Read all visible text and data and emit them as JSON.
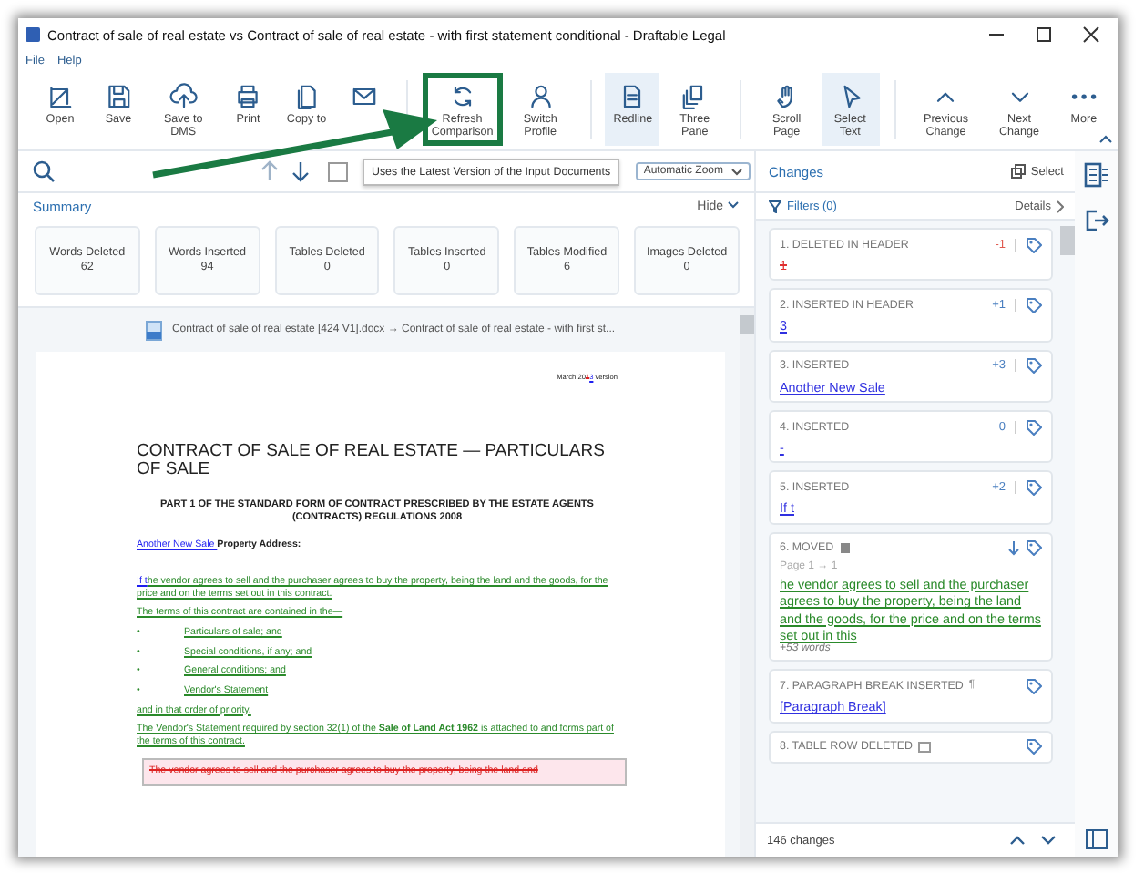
{
  "window": {
    "title": "Contract of sale of real estate vs Contract of sale of real estate - with first statement conditional - Draftable Legal"
  },
  "menu": [
    "File",
    "Help"
  ],
  "toolbar": [
    {
      "label": "Open",
      "selected": false,
      "highlighted": false,
      "separator_before": false
    },
    {
      "label": "Save",
      "selected": false,
      "highlighted": false,
      "separator_before": false
    },
    {
      "label": "Save to DMS",
      "selected": false,
      "highlighted": false,
      "separator_before": false
    },
    {
      "label": "Print",
      "selected": false,
      "highlighted": false,
      "separator_before": false
    },
    {
      "label": "Copy to",
      "selected": false,
      "highlighted": false,
      "separator_before": false
    },
    {
      "selected": false,
      "highlighted": false,
      "separator_before": false
    },
    {
      "label": "Refresh Comparison",
      "selected": false,
      "highlighted": true,
      "separator_before": true
    },
    {
      "label": "Switch Profile",
      "selected": false,
      "highlighted": false,
      "separator_before": false
    },
    {
      "label": "Redline",
      "selected": true,
      "highlighted": false,
      "separator_before": true
    },
    {
      "label": "Three Pane",
      "selected": false,
      "highlighted": false,
      "separator_before": false
    },
    {
      "label": "Scroll Page",
      "selected": false,
      "highlighted": false,
      "separator_before": true
    },
    {
      "label": "Select Text",
      "selected": true,
      "highlighted": false,
      "separator_before": false
    },
    {
      "label": "Previous Change",
      "selected": false,
      "highlighted": false,
      "separator_before": true
    },
    {
      "label": "Next Change",
      "selected": false,
      "highlighted": false,
      "separator_before": false
    },
    {
      "label": "More",
      "selected": false,
      "highlighted": false,
      "separator_before": false
    }
  ],
  "checkbox": {
    "checked": false
  },
  "tooltip": "Uses the Latest Version of the Input Documents",
  "zoom_select": "Automatic Zoom",
  "summary": {
    "title": "Summary",
    "hide": "Hide",
    "cards": [
      {
        "label": "Words Deleted",
        "value": "62"
      },
      {
        "label": "Words Inserted",
        "value": "94"
      },
      {
        "label": "Tables Deleted",
        "value": "0"
      },
      {
        "label": "Tables Inserted",
        "value": "0"
      },
      {
        "label": "Tables Modified",
        "value": "6"
      },
      {
        "label": "Images Deleted",
        "value": "0"
      }
    ]
  },
  "document": {
    "file_line": "Contract of sale of real estate [424 V1].docx → Contract of sale of real estate - with first st...",
    "header": [
      {
        "text": "March 20",
        "kind": "plain"
      },
      {
        "text": "1",
        "kind": "deleted"
      },
      {
        "text": "3",
        "kind": "inserted"
      },
      {
        "text": " version",
        "kind": "plain"
      }
    ],
    "paragraphs": [
      {
        "kind": "title",
        "segments": [
          {
            "text": "CONTRACT OF SALE OF REAL ESTATE — PARTICULARS OF SALE",
            "kind": "plain"
          }
        ]
      },
      {
        "kind": "subtitle",
        "segments": [
          {
            "text": "PART 1 OF THE STANDARD FORM OF CONTRACT PRESCRIBED BY THE ESTATE AGENTS (CONTRACTS) REGULATIONS 2008",
            "kind": "plain"
          }
        ]
      },
      {
        "kind": "para",
        "segments": [
          {
            "text": "Another New Sale ",
            "kind": "inserted"
          },
          {
            "text": "Property Address:",
            "kind": "bold"
          }
        ]
      },
      {
        "kind": "gap"
      },
      {
        "kind": "para",
        "segments": [
          {
            "text": "If t",
            "kind": "inserted"
          },
          {
            "text": "he vendor agrees to sell and the purchaser agrees to buy the property, being the land and the goods, for the price and on the terms set out in this contract.",
            "kind": "moved"
          }
        ]
      },
      {
        "kind": "para",
        "segments": [
          {
            "text": "The terms of this contract are contained in the—",
            "kind": "moved"
          }
        ]
      },
      {
        "kind": "bullet",
        "bullet": "•",
        "segments": [
          {
            "text": "Particulars of sale; and",
            "kind": "moved"
          }
        ]
      },
      {
        "kind": "bullet",
        "bullet": "•",
        "segments": [
          {
            "text": "Special conditions, if any; and",
            "kind": "moved"
          }
        ]
      },
      {
        "kind": "bullet",
        "bullet": "•",
        "segments": [
          {
            "text": "General conditions; and",
            "kind": "moved"
          }
        ]
      },
      {
        "kind": "bullet",
        "bullet": "•",
        "segments": [
          {
            "text": "Vendor's Statement",
            "kind": "moved"
          }
        ]
      },
      {
        "kind": "para",
        "segments": [
          {
            "text": "and in that order of priority.",
            "kind": "moved"
          }
        ]
      },
      {
        "kind": "para",
        "segments": [
          {
            "text": "The Vendor's Statement required by section 32(1) of the ",
            "kind": "moved"
          },
          {
            "text": "Sale of Land Act 1962",
            "kind": "moved-bold"
          },
          {
            "text": " is attached to and forms part of the terms of this contract.",
            "kind": "moved"
          }
        ]
      },
      {
        "kind": "deleted-box",
        "segments": [
          {
            "text": "The vendor agrees to sell and the purchaser agrees to buy the property, being the land and",
            "kind": "deleted"
          }
        ]
      }
    ]
  },
  "changes": {
    "title": "Changes",
    "select": "Select",
    "filters": "Filters (0)",
    "details": "Details",
    "items": [
      {
        "kind": "deleted",
        "title": "1. DELETED IN HEADER",
        "count": "-1",
        "content": "1"
      },
      {
        "kind": "inserted",
        "title": "2. INSERTED IN HEADER",
        "count": "+1",
        "content": "3"
      },
      {
        "kind": "inserted",
        "title": "3. INSERTED",
        "count": "+3",
        "content": "Another New Sale"
      },
      {
        "kind": "inserted",
        "title": "4. INSERTED",
        "count": "0",
        "content": "-"
      },
      {
        "kind": "inserted",
        "title": "5. INSERTED",
        "count": "+2",
        "content": "If t"
      },
      {
        "kind": "moved",
        "title": "6. MOVED",
        "pages": "Page 1 → 1",
        "content": "he vendor agrees to sell and the purchaser agrees to buy the property, being the land and the goods, for the price and on the terms set out in this",
        "more": "+53 words"
      },
      {
        "kind": "break",
        "title": "7. PARAGRAPH BREAK INSERTED",
        "title_glyph": "¶",
        "content": "[Paragraph Break]"
      },
      {
        "kind": "row",
        "title": "8. TABLE ROW DELETED"
      }
    ],
    "total": "146 changes"
  }
}
